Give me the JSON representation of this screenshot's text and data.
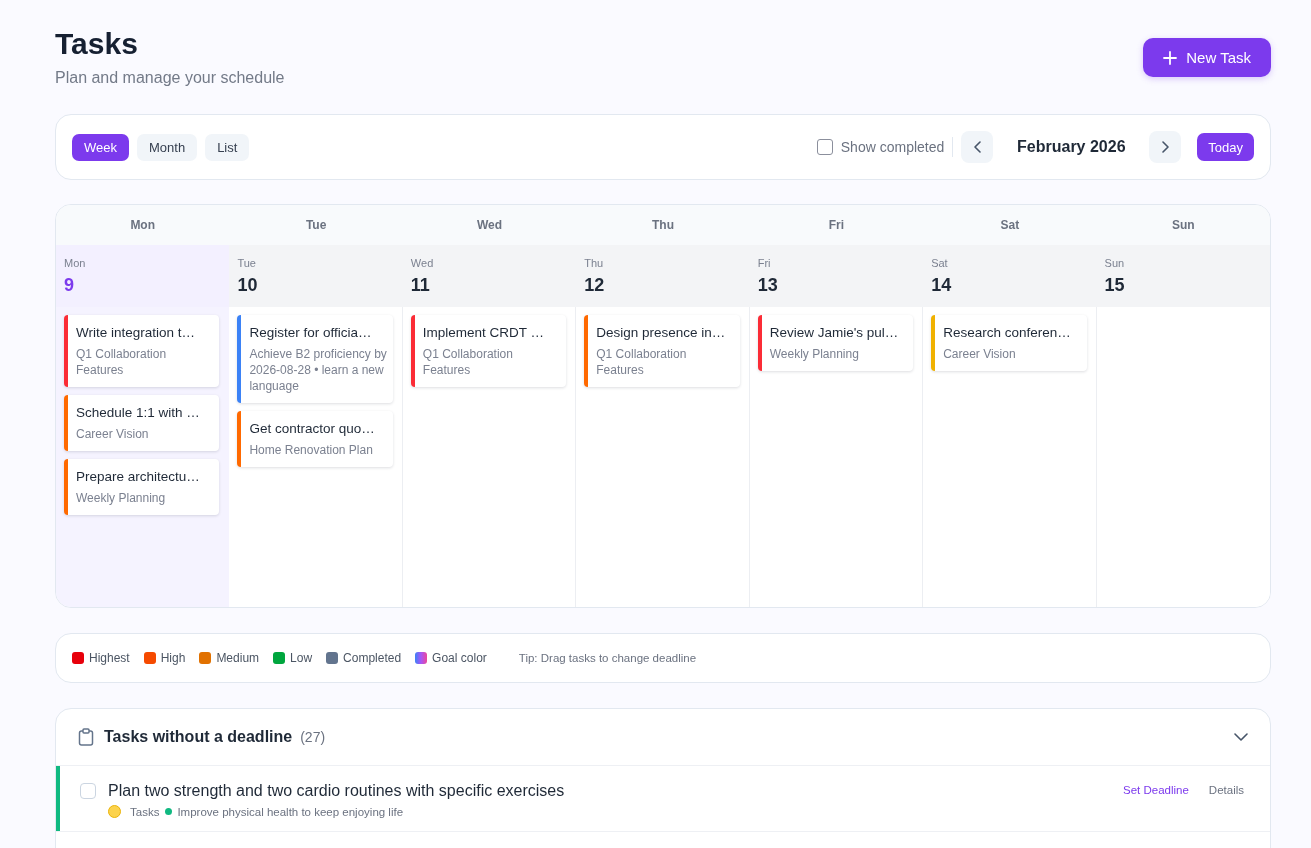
{
  "header": {
    "title": "Tasks",
    "subtitle": "Plan and manage your schedule",
    "new_task_button": "New Task"
  },
  "toolbar": {
    "views": [
      {
        "label": "Week",
        "selected": true
      },
      {
        "label": "Month",
        "selected": false
      },
      {
        "label": "List",
        "selected": false
      }
    ],
    "show_completed": {
      "label": "Show completed",
      "checked": false
    },
    "period": "February 2026",
    "today_button": "Today"
  },
  "calendar": {
    "weekday_headers": [
      "Mon",
      "Tue",
      "Wed",
      "Thu",
      "Fri",
      "Sat",
      "Sun"
    ],
    "days": [
      {
        "weekday": "Mon",
        "date": "9",
        "today": true,
        "tasks": [
          {
            "title": "Write integration t…",
            "goal": "Q1 Collaboration Features",
            "color": "#fb2c36"
          },
          {
            "title": "Schedule 1:1 with …",
            "goal": "Career Vision",
            "color": "#ff6900"
          },
          {
            "title": "Prepare architectu…",
            "goal": "Weekly Planning",
            "color": "#ff6900"
          }
        ]
      },
      {
        "weekday": "Tue",
        "date": "10",
        "today": false,
        "tasks": [
          {
            "title": "Register for officia…",
            "goal": "Achieve B2 proficiency by 2026-08-28 • learn a new language",
            "color": "#3b82f6"
          },
          {
            "title": "Get contractor quo…",
            "goal": "Home Renovation Plan",
            "color": "#ff6900"
          }
        ]
      },
      {
        "weekday": "Wed",
        "date": "11",
        "today": false,
        "tasks": [
          {
            "title": "Implement CRDT …",
            "goal": "Q1 Collaboration Features",
            "color": "#fb2c36"
          }
        ]
      },
      {
        "weekday": "Thu",
        "date": "12",
        "today": false,
        "tasks": [
          {
            "title": "Design presence in…",
            "goal": "Q1 Collaboration Features",
            "color": "#ff6900"
          }
        ]
      },
      {
        "weekday": "Fri",
        "date": "13",
        "today": false,
        "tasks": [
          {
            "title": "Review Jamie's pul…",
            "goal": "Weekly Planning",
            "color": "#fb2c36"
          }
        ]
      },
      {
        "weekday": "Sat",
        "date": "14",
        "today": false,
        "tasks": [
          {
            "title": "Research conferen…",
            "goal": "Career Vision",
            "color": "#f0b100"
          }
        ]
      },
      {
        "weekday": "Sun",
        "date": "15",
        "today": false
      }
    ]
  },
  "legend": {
    "items": [
      {
        "label": "Highest",
        "kind": "solid",
        "color": "#e7000b"
      },
      {
        "label": "High",
        "kind": "solid",
        "color": "#f54a00"
      },
      {
        "label": "Medium",
        "kind": "solid",
        "color": "#e17100"
      },
      {
        "label": "Low",
        "kind": "solid",
        "color": "#00a63e"
      },
      {
        "label": "Completed",
        "kind": "solid",
        "color": "#62748e"
      },
      {
        "label": "Goal color",
        "kind": "gradient"
      }
    ],
    "tip": "Tip: Drag tasks to change deadline"
  },
  "undated_tasks": {
    "title": "Tasks without a deadline",
    "count": "(27)",
    "expanded": true,
    "rows": [
      {
        "title": "Plan two strength and two cardio routines with specific exercises",
        "checked": false,
        "list": "Tasks",
        "goal": {
          "name": "Improve physical health to keep enjoying life",
          "color": "#10b981"
        },
        "actions": [
          {
            "label": "Set Deadline",
            "kind": "primary"
          },
          {
            "label": "Details",
            "kind": "secondary"
          }
        ]
      }
    ]
  }
}
